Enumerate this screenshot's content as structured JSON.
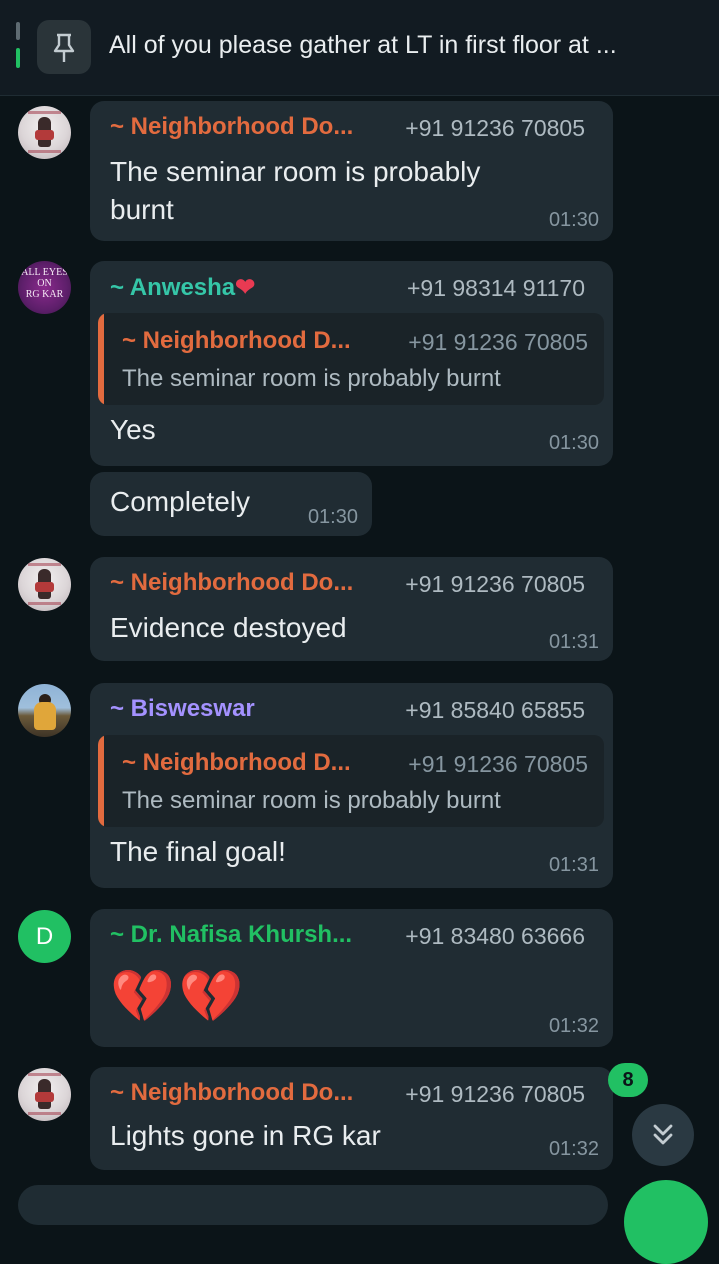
{
  "pinned": {
    "text": "All of you please gather at LT in first floor at ..."
  },
  "messages": [
    {
      "sender": "~ Neighborhood Do...",
      "phone": "+91 91236 70805",
      "text": "The seminar room is probably\nburnt",
      "time": "01:30"
    },
    {
      "sender": "~ Anwesha",
      "sender_emoji": "❤",
      "phone": "+91 98314 91170",
      "avatar_text": "ALL EYES\nON\nRG KAR",
      "quote": {
        "sender": "~ Neighborhood D...",
        "phone": "+91 91236 70805",
        "text": "The seminar room is probably burnt"
      },
      "text": "Yes",
      "time": "01:30"
    },
    {
      "text": "Completely",
      "time": "01:30"
    },
    {
      "sender": "~ Neighborhood Do...",
      "phone": "+91 91236 70805",
      "text": "Evidence destoyed",
      "time": "01:31"
    },
    {
      "sender": "~ Bisweswar",
      "phone": "+91 85840 65855",
      "quote": {
        "sender": "~ Neighborhood D...",
        "phone": "+91 91236 70805",
        "text": "The seminar room is probably burnt"
      },
      "text": "The final goal!",
      "time": "01:31"
    },
    {
      "sender": "~ Dr. Nafisa Khursh...",
      "phone": "+91 83480 63666",
      "avatar_letter": "D",
      "text": "💔💔",
      "time": "01:32"
    },
    {
      "sender": "~ Neighborhood Do...",
      "phone": "+91 91236 70805",
      "text": "Lights gone in RG kar",
      "time": "01:32"
    }
  ],
  "unread_badge": "8",
  "colors": {
    "background": "#0b1418",
    "bubble": "#202c33",
    "accent_green": "#21c063",
    "orange_sender": "#e26b3f",
    "teal_sender": "#35c6a8",
    "purple_sender": "#a492ff"
  },
  "icons": [
    "pin-icon",
    "chevrons-down-icon"
  ]
}
